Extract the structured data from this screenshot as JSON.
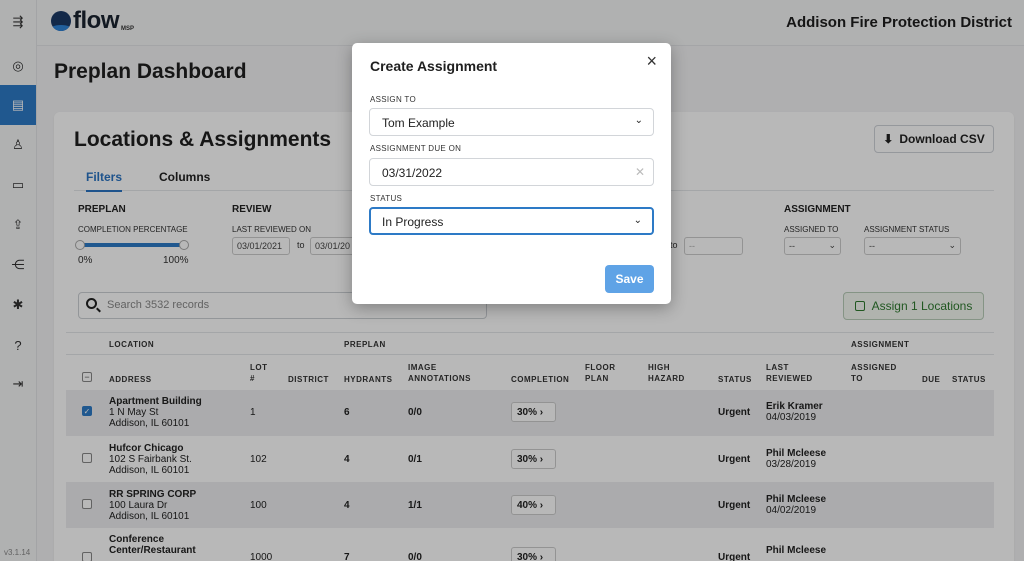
{
  "app": {
    "logo_text": "flow",
    "logo_sub": "MSP",
    "org_name": "Addison Fire Protection District",
    "version": "v3.1.14"
  },
  "sidebar": {
    "icons": [
      "menu-toggle-icon",
      "compass-icon",
      "list-icon",
      "user-icon",
      "id-card-icon",
      "upload-icon",
      "share-icon",
      "gear-icon",
      "help-icon",
      "logout-icon"
    ],
    "active_index": 2
  },
  "page": {
    "title": "Preplan Dashboard",
    "card_title": "Locations & Assignments",
    "download_csv": "Download CSV",
    "tabs": [
      "Filters",
      "Columns"
    ],
    "active_tab": "Filters"
  },
  "filters": {
    "preplan": {
      "heading": "PREPLAN",
      "completion_label": "COMPLETION PERCENTAGE",
      "min": "0%",
      "max": "100%"
    },
    "review": {
      "heading": "REVIEW",
      "last_reviewed_label": "LAST REVIEWED ON",
      "from": "03/01/2021",
      "to_label": "to",
      "to": "03/01/20"
    },
    "hidden_range": {
      "to_label": "to",
      "value": "--"
    },
    "assignment": {
      "heading": "ASSIGNMENT",
      "assigned_to_label": "ASSIGNED TO",
      "assigned_to_value": "--",
      "status_label": "ASSIGNMENT STATUS",
      "status_value": "--"
    }
  },
  "search": {
    "placeholder": "Search 3532 records"
  },
  "assign_button": "Assign 1 Locations",
  "table": {
    "group_headers": {
      "location": "LOCATION",
      "preplan": "PREPLAN",
      "assignment": "ASSIGNMENT"
    },
    "columns": {
      "address": "ADDRESS",
      "lot_1": "LOT",
      "lot_2": "#",
      "district": "DISTRICT",
      "hydrants": "HYDRANTS",
      "image_1": "IMAGE",
      "image_2": "ANNOTATIONS",
      "completion": "COMPLETION",
      "floor_1": "FLOOR",
      "floor_2": "PLAN",
      "high_1": "HIGH",
      "high_2": "HAZARD",
      "status": "STATUS",
      "last_1": "LAST",
      "last_2": "REVIEWED",
      "assigned_1": "ASSIGNED",
      "assigned_2": "TO",
      "due": "DUE",
      "a_status": "STATUS"
    },
    "rows": [
      {
        "name": "Apartment Building",
        "addr1": "1 N May St",
        "addr2": "Addison, IL 60101",
        "lot": "1",
        "hydrants": "6",
        "annotations": "0/0",
        "completion": "30%",
        "status": "Urgent",
        "reviewer": "Erik Kramer",
        "reviewed": "04/03/2019",
        "checked": true
      },
      {
        "name": "Hufcor Chicago",
        "addr1": "102 S Fairbank St.",
        "addr2": "Addison, IL 60101",
        "lot": "102",
        "hydrants": "4",
        "annotations": "0/1",
        "completion": "30%",
        "status": "Urgent",
        "reviewer": "Phil Mcleese",
        "reviewed": "03/28/2019",
        "checked": false
      },
      {
        "name": "RR SPRING CORP",
        "addr1": "100 Laura Dr",
        "addr2": "Addison, IL 60101",
        "lot": "100",
        "hydrants": "4",
        "annotations": "1/1",
        "completion": "40%",
        "status": "Urgent",
        "reviewer": "Phil Mcleese",
        "reviewed": "04/02/2019",
        "checked": false
      },
      {
        "name": "Conference",
        "name2": "Center/Restaurant",
        "lot": "1000",
        "hydrants": "7",
        "annotations": "0/0",
        "completion": "30%",
        "status": "Urgent",
        "reviewer": "Phil Mcleese",
        "checked": false
      }
    ]
  },
  "modal": {
    "title": "Create Assignment",
    "assign_to_label": "ASSIGN TO",
    "assign_to_value": "Tom Example",
    "due_label": "ASSIGNMENT DUE ON",
    "due_value": "03/31/2022",
    "status_label": "STATUS",
    "status_value": "In Progress",
    "save": "Save"
  }
}
